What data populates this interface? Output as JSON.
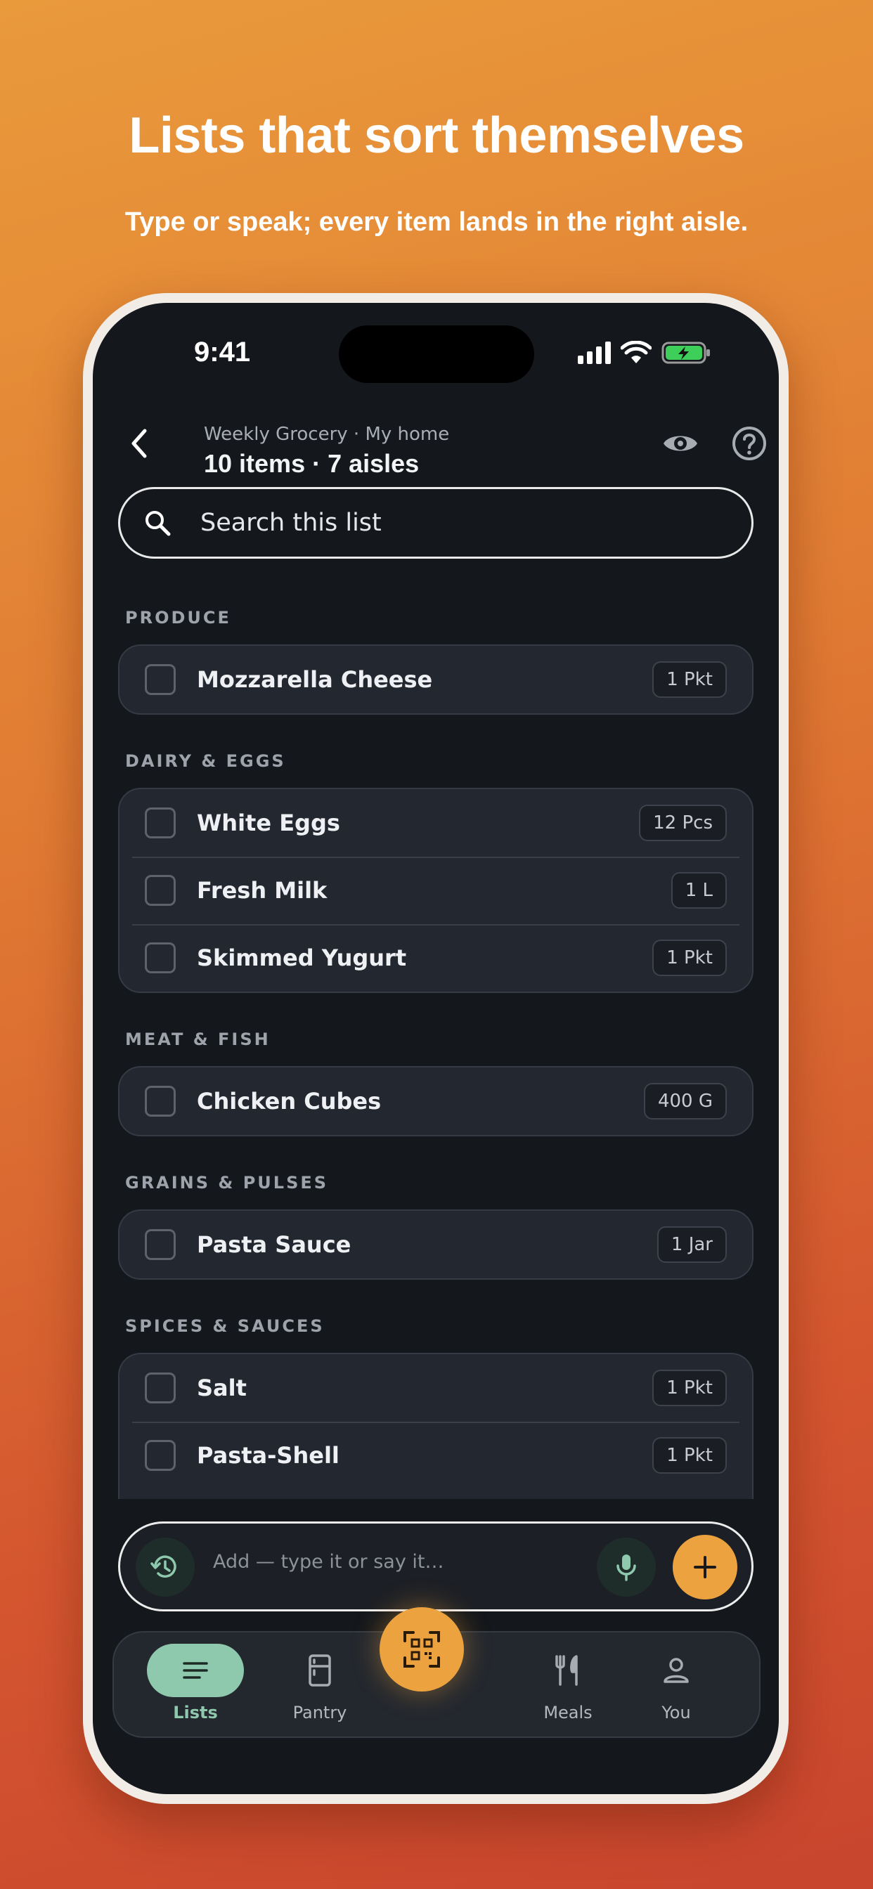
{
  "promo": {
    "headline": "Lists that sort themselves",
    "subhead": "Type or speak; every item lands in the right aisle."
  },
  "status_bar": {
    "time": "9:41"
  },
  "header": {
    "subtitle": "Weekly Grocery · My home",
    "title": "10 items · 7 aisles"
  },
  "search": {
    "placeholder": "Search this list"
  },
  "sections": [
    {
      "label": "PRODUCE",
      "items": [
        {
          "name": "Mozzarella Cheese",
          "qty": "1 Pkt"
        }
      ]
    },
    {
      "label": "DAIRY & EGGS",
      "items": [
        {
          "name": "White Eggs",
          "qty": "12 Pcs"
        },
        {
          "name": "Fresh Milk",
          "qty": "1 L"
        },
        {
          "name": "Skimmed Yugurt",
          "qty": "1 Pkt"
        }
      ]
    },
    {
      "label": "MEAT & FISH",
      "items": [
        {
          "name": "Chicken Cubes",
          "qty": "400 G"
        }
      ]
    },
    {
      "label": "GRAINS & PULSES",
      "items": [
        {
          "name": "Pasta Sauce",
          "qty": "1 Jar"
        }
      ]
    },
    {
      "label": "SPICES & SAUCES",
      "items": [
        {
          "name": "Salt",
          "qty": "1 Pkt"
        },
        {
          "name": "Pasta-Shell",
          "qty": "1 Pkt"
        }
      ]
    }
  ],
  "add_bar": {
    "placeholder": "Add — type it or say it…"
  },
  "nav": {
    "items": [
      {
        "label": "Lists",
        "icon": "list-icon",
        "active": true
      },
      {
        "label": "Pantry",
        "icon": "fridge-icon"
      },
      {
        "label": "Meals",
        "icon": "fork-knife-icon"
      },
      {
        "label": "You",
        "icon": "person-icon"
      }
    ],
    "center_icon": "qr-scan-icon"
  },
  "colors": {
    "accent": "#eba23f",
    "active_green": "#8fc9ad",
    "screen_bg": "#14171b",
    "card_bg": "#232730"
  }
}
